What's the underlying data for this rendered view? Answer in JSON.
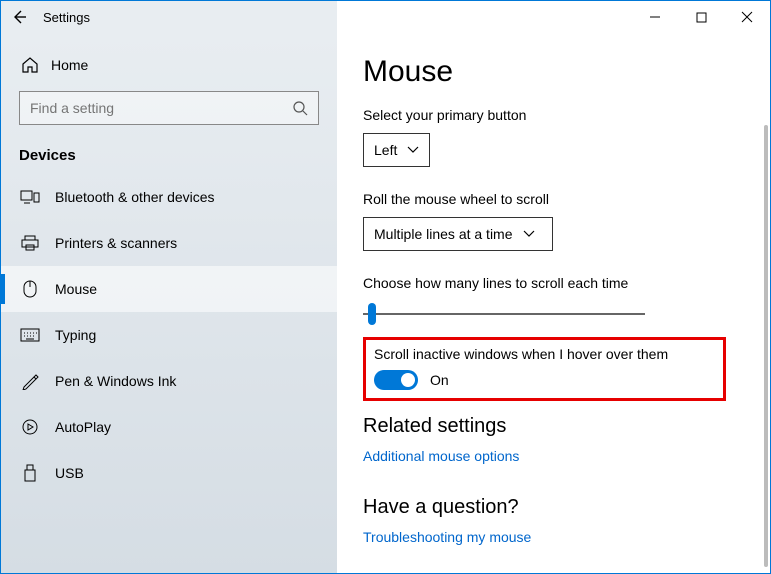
{
  "titlebar": {
    "title": "Settings"
  },
  "sidebar": {
    "home_label": "Home",
    "search_placeholder": "Find a setting",
    "category": "Devices",
    "items": [
      {
        "label": "Bluetooth & other devices"
      },
      {
        "label": "Printers & scanners"
      },
      {
        "label": "Mouse"
      },
      {
        "label": "Typing"
      },
      {
        "label": "Pen & Windows Ink"
      },
      {
        "label": "AutoPlay"
      },
      {
        "label": "USB"
      }
    ]
  },
  "main": {
    "page_title": "Mouse",
    "primary_button_label": "Select your primary button",
    "primary_button_value": "Left",
    "roll_label": "Roll the mouse wheel to scroll",
    "roll_value": "Multiple lines at a time",
    "lines_label": "Choose how many lines to scroll each time",
    "scroll_inactive_label": "Scroll inactive windows when I hover over them",
    "scroll_inactive_state": "On",
    "related_header": "Related settings",
    "related_link": "Additional mouse options",
    "question_header": "Have a question?",
    "question_link": "Troubleshooting my mouse"
  }
}
